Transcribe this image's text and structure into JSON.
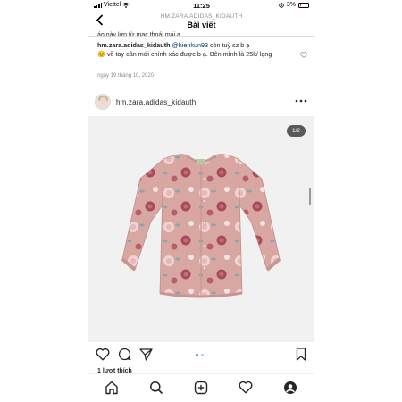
{
  "status_bar": {
    "carrier": "Viettel",
    "time": "11:25",
    "battery": "3%"
  },
  "header": {
    "username": "HM.ZARA.ADIDAS_KIDAUTH",
    "title": "Bài viết"
  },
  "previous_comment_fragment": "áo này lớn từ mạc thoái mái ạ",
  "comment": {
    "author": "hm.zara.adidas_kidauth",
    "mention": "@hienkun93",
    "text_part1": " còn tuỳ sz b ạ",
    "emoji": "😊",
    "text_part2": " về tay cân mới chính xác được b ạ. Bên mình là 25k/ lạng",
    "date": "ngày 19 tháng 10, 2020"
  },
  "post": {
    "username": "hm.zara.adidas_kidauth",
    "image_counter": "1/2",
    "image_description": "floral pink baby cardigan",
    "carousel": {
      "count": 2,
      "active": 0
    },
    "likes": "1 lượt thích"
  },
  "colors": {
    "cardigan": "#d9a7a2",
    "rose_dark": "#a84a5a",
    "rose_light": "#f0d3d3",
    "leaf": "#8fa3a8",
    "accent_blue": "#3897f0"
  },
  "icons": {
    "back": "chevron-left-icon",
    "more": "more-options-icon",
    "like": "heart-icon",
    "comment": "comment-icon",
    "share": "paper-plane-icon",
    "save": "bookmark-icon",
    "home": "home-icon",
    "search": "search-icon",
    "new_post": "add-post-icon",
    "activity": "heart-icon",
    "profile": "profile-icon"
  }
}
